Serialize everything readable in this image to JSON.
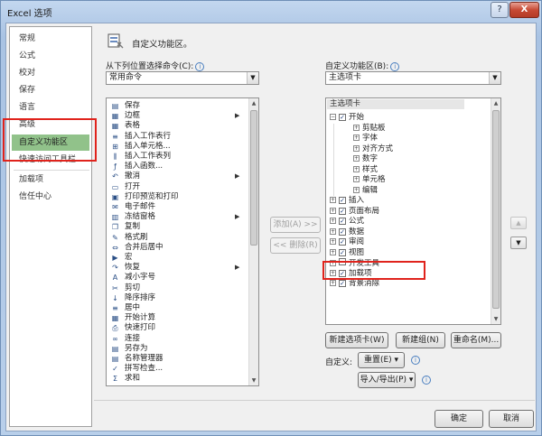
{
  "window": {
    "title": "Excel 选项",
    "help": "?",
    "close": "X"
  },
  "nav": {
    "items": [
      {
        "label": "常规"
      },
      {
        "label": "公式"
      },
      {
        "label": "校对"
      },
      {
        "label": "保存"
      },
      {
        "label": "语言"
      },
      {
        "label": "高级"
      },
      {
        "label": "自定义功能区"
      },
      {
        "label": "快速访问工具栏"
      },
      {
        "label": "加载项"
      },
      {
        "label": "信任中心"
      }
    ],
    "selected_index": 6
  },
  "main": {
    "section_title": "自定义功能区。",
    "choose_from_label": "从下列位置选择命令(C):",
    "choose_from_value": "常用命令",
    "customize_label": "自定义功能区(B):",
    "customize_value": "主选项卡",
    "info": "i",
    "commands": [
      {
        "label": "保存",
        "icon": "floppy-icon",
        "glyph": "▤",
        "submenu": false
      },
      {
        "label": "边框",
        "icon": "border-icon",
        "glyph": "▦",
        "submenu": true
      },
      {
        "label": "表格",
        "icon": "table-icon",
        "glyph": "▦",
        "submenu": false
      },
      {
        "label": "插入工作表行",
        "icon": "insert-row-icon",
        "glyph": "≡",
        "submenu": false
      },
      {
        "label": "插入单元格...",
        "icon": "insert-cell-icon",
        "glyph": "⊞",
        "submenu": false
      },
      {
        "label": "插入工作表列",
        "icon": "insert-column-icon",
        "glyph": "⫼",
        "submenu": false
      },
      {
        "label": "插入函数...",
        "icon": "function-icon",
        "glyph": "ƒ",
        "submenu": false
      },
      {
        "label": "撤消",
        "icon": "undo-icon",
        "glyph": "↶",
        "submenu": true
      },
      {
        "label": "打开",
        "icon": "folder-open-icon",
        "glyph": "▭",
        "submenu": false
      },
      {
        "label": "打印预览和打印",
        "icon": "print-preview-icon",
        "glyph": "▣",
        "submenu": false
      },
      {
        "label": "电子邮件",
        "icon": "email-icon",
        "glyph": "✉",
        "submenu": false
      },
      {
        "label": "冻结窗格",
        "icon": "freeze-panes-icon",
        "glyph": "▥",
        "submenu": true
      },
      {
        "label": "复制",
        "icon": "copy-icon",
        "glyph": "❐",
        "submenu": false
      },
      {
        "label": "格式刷",
        "icon": "format-painter-icon",
        "glyph": "✎",
        "submenu": false
      },
      {
        "label": "合并后居中",
        "icon": "merge-center-icon",
        "glyph": "⇔",
        "submenu": false
      },
      {
        "label": "宏",
        "icon": "macro-icon",
        "glyph": "▶",
        "submenu": false
      },
      {
        "label": "恢复",
        "icon": "redo-icon",
        "glyph": "↷",
        "submenu": true
      },
      {
        "label": "减小字号",
        "icon": "decrease-font-icon",
        "glyph": "A",
        "submenu": false
      },
      {
        "label": "剪切",
        "icon": "cut-icon",
        "glyph": "✂",
        "submenu": false
      },
      {
        "label": "降序排序",
        "icon": "sort-desc-icon",
        "glyph": "↓",
        "submenu": false
      },
      {
        "label": "居中",
        "icon": "align-center-icon",
        "glyph": "≡",
        "submenu": false
      },
      {
        "label": "开始计算",
        "icon": "calculate-icon",
        "glyph": "▦",
        "submenu": false
      },
      {
        "label": "快速打印",
        "icon": "quick-print-icon",
        "glyph": "⎙",
        "submenu": false
      },
      {
        "label": "连接",
        "icon": "connections-icon",
        "glyph": "∞",
        "submenu": false
      },
      {
        "label": "另存为",
        "icon": "save-as-icon",
        "glyph": "▤",
        "submenu": false
      },
      {
        "label": "名称管理器",
        "icon": "name-manager-icon",
        "glyph": "▤",
        "submenu": false
      },
      {
        "label": "拼写检查...",
        "icon": "spelling-icon",
        "glyph": "✓",
        "submenu": false
      },
      {
        "label": "求和",
        "icon": "sum-icon",
        "glyph": "Σ",
        "submenu": false
      }
    ],
    "add_button": "添加(A) >>",
    "remove_button": "<< 删除(R)",
    "tree_header": "主选项卡",
    "tree": [
      {
        "label": "开始",
        "level": 0,
        "expanded": true,
        "checked": true
      },
      {
        "label": "剪贴板",
        "level": 1,
        "expanded": false,
        "checked": null
      },
      {
        "label": "字体",
        "level": 1,
        "expanded": false,
        "checked": null
      },
      {
        "label": "对齐方式",
        "level": 1,
        "expanded": false,
        "checked": null
      },
      {
        "label": "数字",
        "level": 1,
        "expanded": false,
        "checked": null
      },
      {
        "label": "样式",
        "level": 1,
        "expanded": false,
        "checked": null
      },
      {
        "label": "单元格",
        "level": 1,
        "expanded": false,
        "checked": null
      },
      {
        "label": "编辑",
        "level": 1,
        "expanded": false,
        "checked": null
      },
      {
        "label": "插入",
        "level": 0,
        "expanded": false,
        "checked": true
      },
      {
        "label": "页面布局",
        "level": 0,
        "expanded": false,
        "checked": true
      },
      {
        "label": "公式",
        "level": 0,
        "expanded": false,
        "checked": true
      },
      {
        "label": "数据",
        "level": 0,
        "expanded": false,
        "checked": true
      },
      {
        "label": "审阅",
        "level": 0,
        "expanded": false,
        "checked": true
      },
      {
        "label": "视图",
        "level": 0,
        "expanded": false,
        "checked": true
      },
      {
        "label": "开发工具",
        "level": 0,
        "expanded": false,
        "checked": false
      },
      {
        "label": "加载项",
        "level": 0,
        "expanded": false,
        "checked": true
      },
      {
        "label": "背景消除",
        "level": 0,
        "expanded": false,
        "checked": true
      }
    ],
    "new_tab_button": "新建选项卡(W)",
    "new_group_button": "新建组(N)",
    "rename_button": "重命名(M)...",
    "customizations_label": "自定义:",
    "reset_button": "重置(E) ▾",
    "import_export_button": "导入/导出(P) ▾",
    "move_up": "▲",
    "move_down": "▼"
  },
  "footer": {
    "ok": "确定",
    "cancel": "取消"
  },
  "colors": {
    "nav_selected": "#91c28a",
    "highlight_box": "#e0231c"
  }
}
